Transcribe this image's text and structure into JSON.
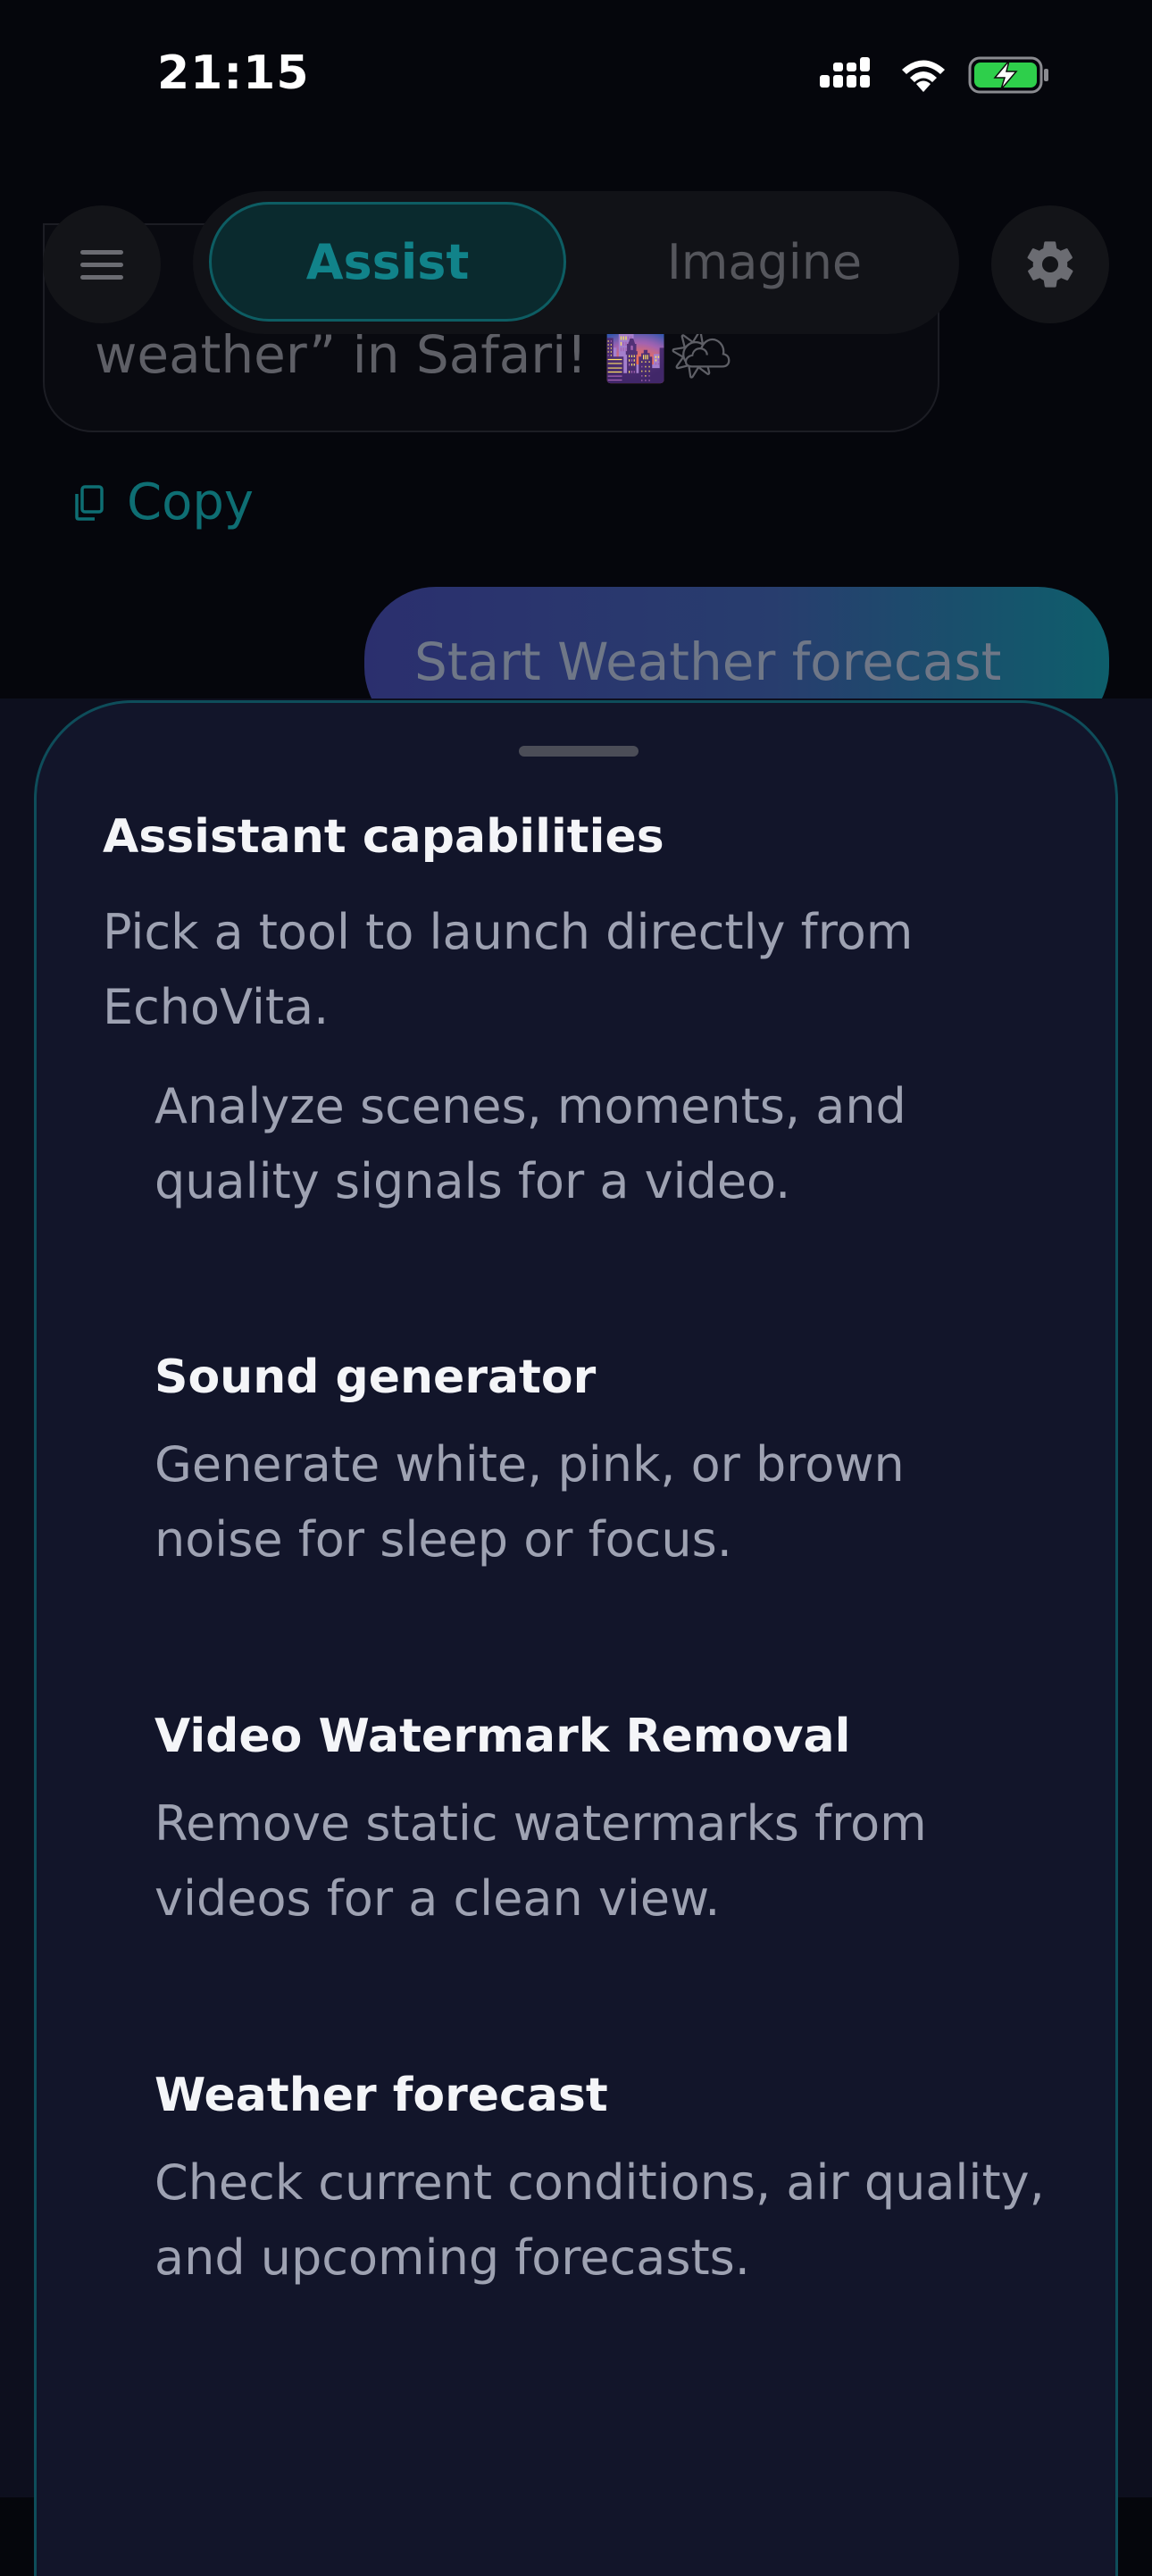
{
  "status_bar": {
    "time": "21:15",
    "icons": [
      "cellular-signal-icon",
      "wifi-icon",
      "battery-charging-icon"
    ]
  },
  "header": {
    "tabs": [
      {
        "label": "Assist",
        "selected": true
      },
      {
        "label": "Imagine",
        "selected": false
      }
    ],
    "menu_icon": "hamburger-menu-icon",
    "settings_icon": "gear-icon"
  },
  "chat": {
    "assistant_message_partial": "weather” in Safari! 🌆🌤",
    "copy_label": "Copy",
    "user_message": "Start Weather forecast"
  },
  "sheet": {
    "title": "Assistant capabilities",
    "subtitle": "Pick a tool to launch directly from EchoVita.",
    "tools": [
      {
        "title": "",
        "description": "Analyze scenes, moments, and quality signals for a video."
      },
      {
        "title": "Sound generator",
        "description": "Generate white, pink, or brown noise for sleep or focus."
      },
      {
        "title": "Video Watermark Removal",
        "description": "Remove static watermarks from videos for a clean view."
      },
      {
        "title": "Weather forecast",
        "description": "Check current conditions, air quality, and upcoming forecasts."
      }
    ]
  },
  "colors": {
    "accent_teal": "#11838a",
    "sheet_background": "#12152a",
    "sheet_border": "#0e4d5a",
    "background": "#05060c"
  }
}
